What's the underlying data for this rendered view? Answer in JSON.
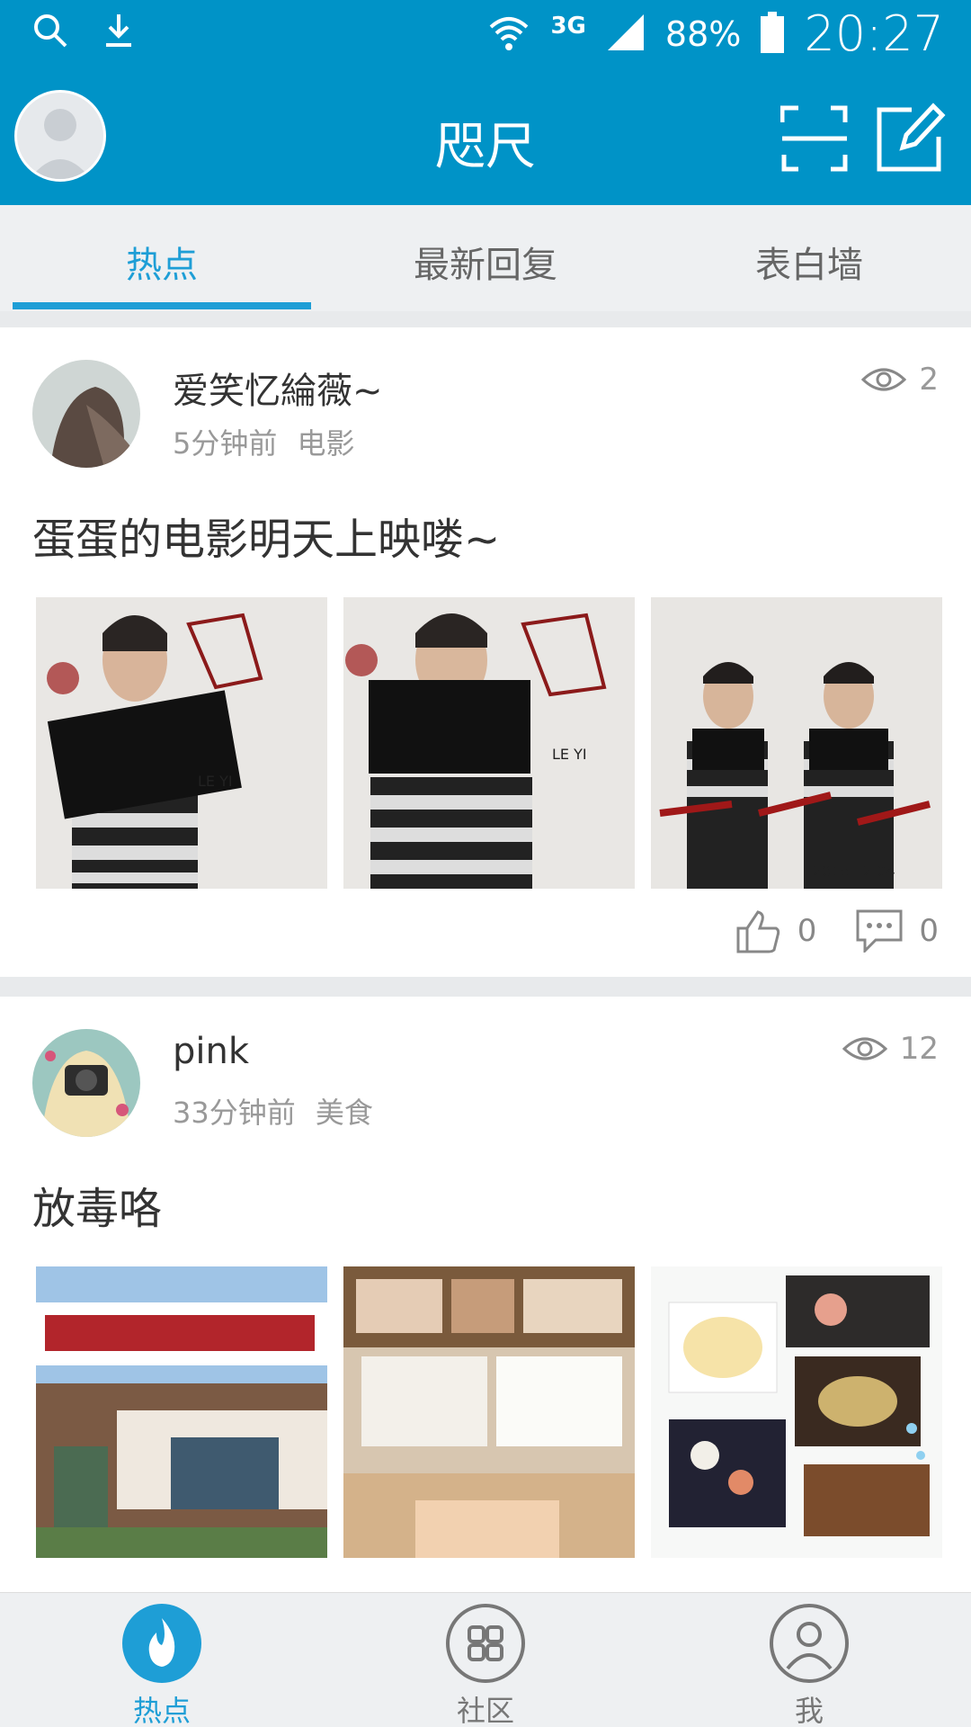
{
  "status_bar": {
    "battery": "88%",
    "time": "20:27",
    "network": "3G"
  },
  "header": {
    "title": "咫尺"
  },
  "tabs": [
    {
      "label": "热点",
      "active": true
    },
    {
      "label": "最新回复",
      "active": false
    },
    {
      "label": "表白墙",
      "active": false
    }
  ],
  "posts": [
    {
      "user": "爱笑忆綸薇~",
      "time": "5分钟前",
      "category": "电影",
      "views": "2",
      "content": "蛋蛋的电影明天上映喽~",
      "likes": "0",
      "comments": "0"
    },
    {
      "user": "pink",
      "time": "33分钟前",
      "category": "美食",
      "views": "12",
      "content": "放毒咯"
    }
  ],
  "bottom_nav": [
    {
      "label": "热点",
      "active": true
    },
    {
      "label": "社区",
      "active": false
    },
    {
      "label": "我",
      "active": false
    }
  ],
  "colors": {
    "primary": "#0093c7",
    "accent": "#1e9ed6",
    "text": "#333333",
    "muted": "#999999"
  }
}
